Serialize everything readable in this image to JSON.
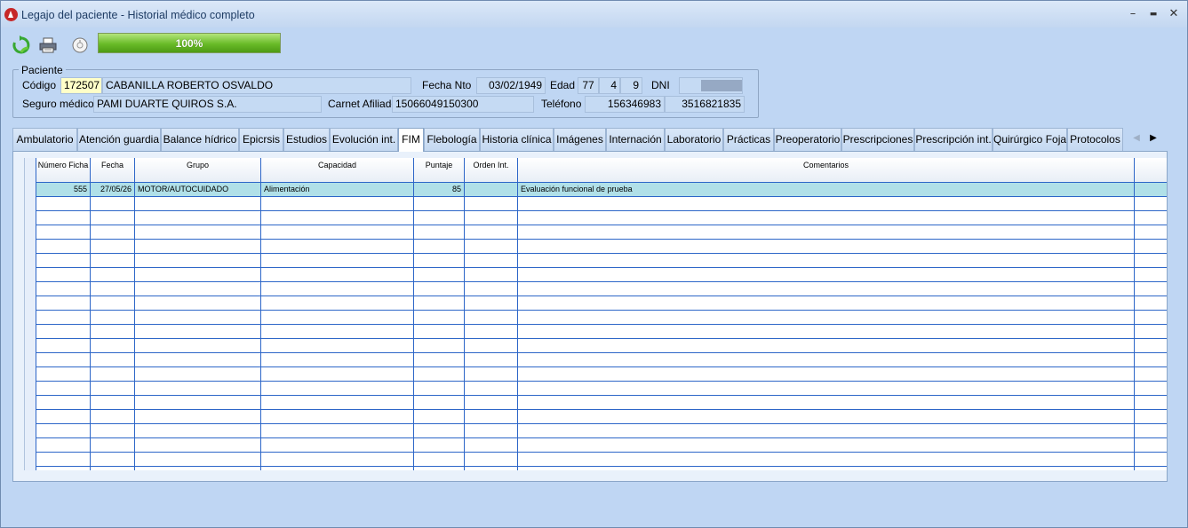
{
  "window": {
    "title": "Legajo del paciente - Historial médico completo",
    "minimize": "–",
    "maximize": "▬",
    "close": "✕"
  },
  "toolbar": {
    "refresh_icon": "refresh-icon",
    "print_icon": "printer-icon",
    "filter_icon": "filter-icon",
    "progress": {
      "value_percent": 100,
      "label": "100%"
    }
  },
  "patient": {
    "legend": "Paciente",
    "codigo_label": "Código",
    "codigo": "172507",
    "nombre": "CABANILLA ROBERTO OSVALDO",
    "fecha_nto_label": "Fecha Nto",
    "fecha_nto": "03/02/1949",
    "edad_label": "Edad",
    "edad_anios": "77",
    "edad_meses": "4",
    "edad_dias": "9",
    "dni_label": "DNI",
    "dni": "",
    "seguro_label": "Seguro médico",
    "seguro": "PAMI DUARTE QUIROS S.A.",
    "carnet_label": "Carnet Afiliado",
    "carnet": "15066049150300",
    "telefono_label": "Teléfono",
    "telefono_1": "156346983",
    "telefono_2": "3516821835"
  },
  "tabs": [
    {
      "label": "Ambulatorio"
    },
    {
      "label": "Atención guardia"
    },
    {
      "label": "Balance hídrico"
    },
    {
      "label": "Epicrsis"
    },
    {
      "label": "Estudios"
    },
    {
      "label": "Evolución int."
    },
    {
      "label": "FIM",
      "active": true
    },
    {
      "label": "Flebología"
    },
    {
      "label": "Historia clínica"
    },
    {
      "label": "Imágenes"
    },
    {
      "label": "Internación"
    },
    {
      "label": "Laboratorio"
    },
    {
      "label": "Prácticas"
    },
    {
      "label": "Preoperatorio"
    },
    {
      "label": "Prescripciones"
    },
    {
      "label": "Prescripción int."
    },
    {
      "label": "Quirúrgico Foja"
    },
    {
      "label": "Protocolos"
    }
  ],
  "tab_scroll": {
    "left": "◀",
    "right": "▶"
  },
  "grid": {
    "columns": [
      "",
      "Número Ficha",
      "Fecha",
      "Grupo",
      "Capacidad",
      "Puntaje",
      "Orden Int.",
      "Comentarios"
    ],
    "rows": [
      [
        "",
        "555",
        "27/05/26",
        "MOTOR/AUTOCUIDADO",
        "Alimentación",
        "85",
        "",
        "Evaluación funcional de prueba"
      ]
    ],
    "empty_rows": 20
  }
}
